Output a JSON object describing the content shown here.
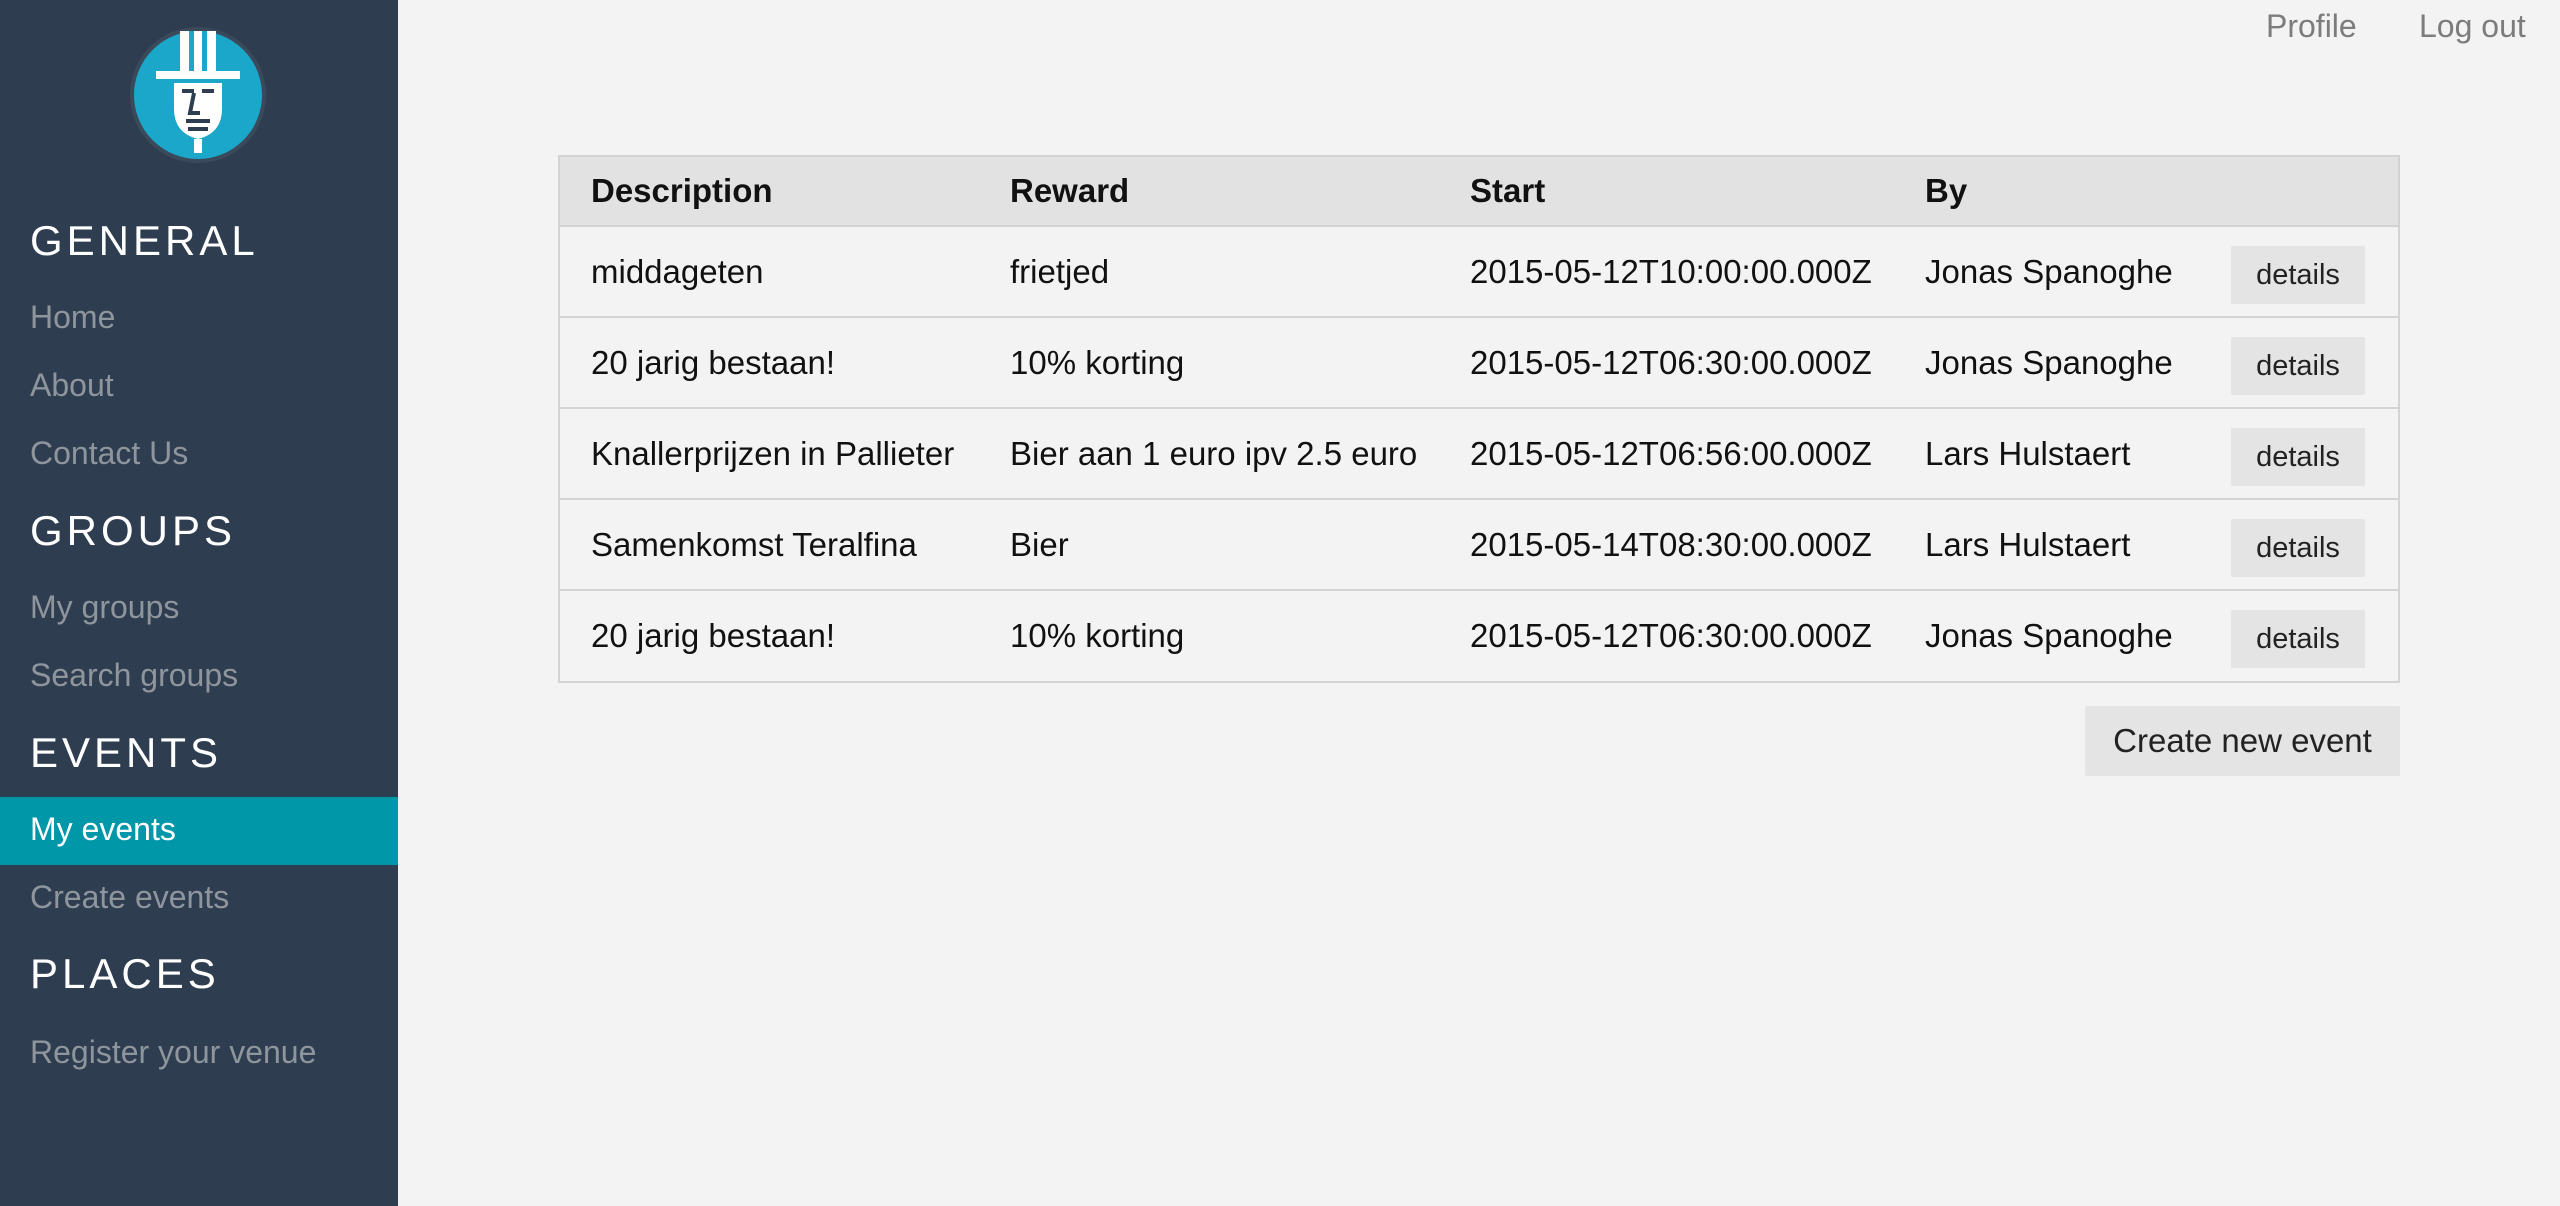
{
  "topnav": {
    "profile_label": "Profile",
    "logout_label": "Log out"
  },
  "sidebar": {
    "logo_icon": "magician-face-icon",
    "sections": {
      "general": {
        "heading": "GENERAL",
        "items": [
          "Home",
          "About",
          "Contact Us"
        ]
      },
      "groups": {
        "heading": "GROUPS",
        "items": [
          "My groups",
          "Search groups"
        ]
      },
      "events": {
        "heading": "EVENTS",
        "items": [
          "My events",
          "Create events"
        ],
        "active": "My events"
      },
      "places": {
        "heading": "PLACES",
        "items": [
          "Register your venue"
        ]
      }
    }
  },
  "table": {
    "headers": {
      "description": "Description",
      "reward": "Reward",
      "start": "Start",
      "by": "By"
    },
    "rows": [
      {
        "description": "middageten",
        "reward": "frietjed",
        "start": "2015-05-12T10:00:00.000Z",
        "by": "Jonas Spanoghe",
        "action": "details"
      },
      {
        "description": "20 jarig bestaan!",
        "reward": "10% korting",
        "start": "2015-05-12T06:30:00.000Z",
        "by": "Jonas Spanoghe",
        "action": "details"
      },
      {
        "description": "Knallerprijzen in Pallieter",
        "reward": "Bier aan 1 euro ipv 2.5 euro",
        "start": "2015-05-12T06:56:00.000Z",
        "by": "Lars Hulstaert",
        "action": "details"
      },
      {
        "description": "Samenkomst Teralfina",
        "reward": "Bier",
        "start": "2015-05-14T08:30:00.000Z",
        "by": "Lars Hulstaert",
        "action": "details"
      },
      {
        "description": "20 jarig bestaan!",
        "reward": "10% korting",
        "start": "2015-05-12T06:30:00.000Z",
        "by": "Jonas Spanoghe",
        "action": "details"
      }
    ]
  },
  "create_button_label": "Create new event",
  "colors": {
    "sidebar_bg": "#2e3e50",
    "accent": "#0097a9",
    "logo_bg": "#1aa7c9"
  }
}
